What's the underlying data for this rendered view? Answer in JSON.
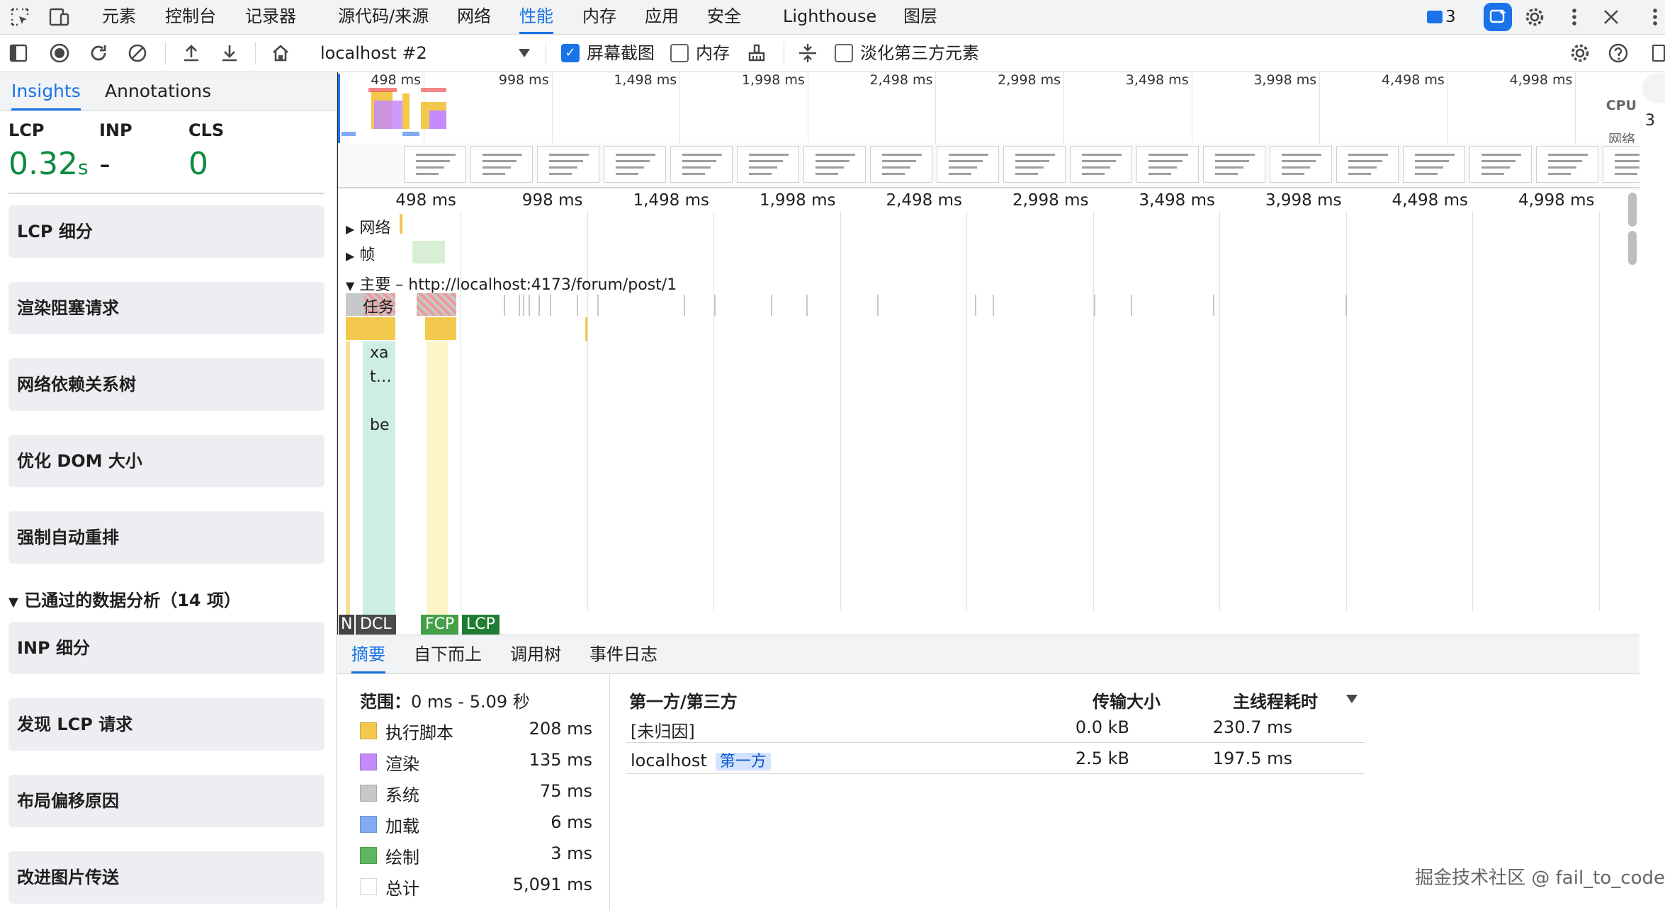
{
  "top_tabs": [
    "元素",
    "控制台",
    "记录器",
    "源代码/来源",
    "网络",
    "性能",
    "内存",
    "应用",
    "安全",
    "Lighthouse",
    "图层"
  ],
  "active_tab": "性能",
  "messages_count": "3",
  "toolbar": {
    "target": "localhost #2",
    "screenshot_label": "屏幕截图",
    "screenshot_checked": true,
    "memory_label": "内存",
    "memory_checked": false,
    "dim_third_party_label": "淡化第三方元素",
    "dim_third_party_checked": false
  },
  "sidebar": {
    "tabs": [
      "Insights",
      "Annotations"
    ],
    "active_tab": "Insights",
    "metrics": {
      "lcp_label": "LCP",
      "lcp_value": "0.32",
      "lcp_unit": "s",
      "inp_label": "INP",
      "inp_value": "-",
      "cls_label": "CLS",
      "cls_value": "0"
    },
    "insights": [
      "LCP 细分",
      "渲染阻塞请求",
      "网络依赖关系树",
      "优化 DOM 大小",
      "强制自动重排"
    ],
    "passed_header": "已通过的数据分析（14 项）",
    "passed": [
      "INP 细分",
      "发现 LCP 请求",
      "布局偏移原因",
      "改进图片传送"
    ]
  },
  "timeline": {
    "overview_ticks": [
      "498 ms",
      "998 ms",
      "1,498 ms",
      "1,998 ms",
      "2,498 ms",
      "2,998 ms",
      "3,498 ms",
      "3,998 ms",
      "4,498 ms",
      "4,998 ms"
    ],
    "overview_labels": {
      "cpu": "CPU",
      "net": "网络"
    },
    "ruler_ticks": [
      "498 ms",
      "998 ms",
      "1,498 ms",
      "1,998 ms",
      "2,498 ms",
      "2,998 ms",
      "3,498 ms",
      "3,998 ms",
      "4,498 ms",
      "4,998 ms"
    ],
    "tracks": {
      "network": "网络",
      "frames": "帧",
      "main": "主要 – http://localhost:4173/forum/post/1"
    },
    "task_label": "任务",
    "flame_labels": [
      "xa",
      "t…",
      "be"
    ],
    "markers": {
      "n": "N",
      "dcl": "DCL",
      "fcp": "FCP",
      "lcp": "LCP"
    },
    "right_edge": "3"
  },
  "bottom": {
    "tabs": [
      "摘要",
      "自下而上",
      "调用树",
      "事件日志"
    ],
    "active_tab": "摘要",
    "range_label": "范围：",
    "range_value": "0 ms - 5.09 秒",
    "summary": [
      {
        "label": "执行脚本",
        "value": "208 ms",
        "color": "#f2c94c"
      },
      {
        "label": "渲染",
        "value": "135 ms",
        "color": "#c58af9"
      },
      {
        "label": "系统",
        "value": "75 ms",
        "color": "#c8c8c8"
      },
      {
        "label": "加载",
        "value": "6 ms",
        "color": "#82aaf5"
      },
      {
        "label": "绘制",
        "value": "3 ms",
        "color": "#5cb860"
      },
      {
        "label": "总计",
        "value": "5,091 ms",
        "color": "#ffffff"
      }
    ],
    "table_headers": {
      "party": "第一方/第三方",
      "transfer": "传输大小",
      "main_thread": "主线程耗时"
    },
    "rows": [
      {
        "name": "[未归因]",
        "badge": "",
        "transfer": "0.0 kB",
        "time": "230.7 ms"
      },
      {
        "name": "localhost",
        "badge": "第一方",
        "transfer": "2.5 kB",
        "time": "197.5 ms"
      }
    ]
  },
  "watermark": "掘金技术社区 @ fail_to_code"
}
